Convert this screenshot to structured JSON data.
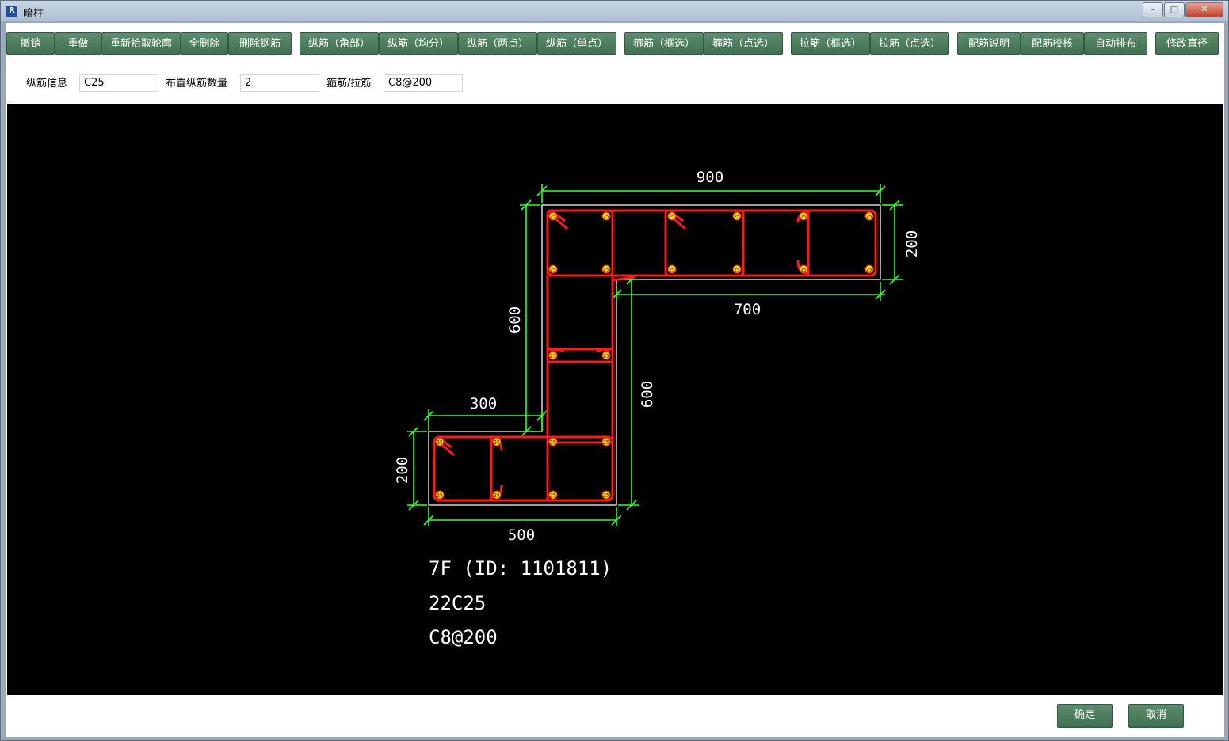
{
  "window": {
    "title": "暗柱"
  },
  "toolbar": {
    "buttons": [
      "撤销",
      "重做",
      "重新拾取轮廓",
      "全删除",
      "删除钢筋",
      "纵筋（角部）",
      "纵筋（均分）",
      "纵筋（两点）",
      "纵筋（单点）",
      "箍筋（框选）",
      "箍筋（点选）",
      "拉筋（框选）",
      "拉筋（点选）",
      "配筋说明",
      "配筋校核",
      "自动排布",
      "修改直径"
    ]
  },
  "fields": {
    "long_rebar_label": "纵筋信息",
    "long_rebar_value": "C25",
    "count_label": "布置纵筋数量",
    "count_value": "2",
    "stirrup_label": "箍筋/拉筋",
    "stirrup_value": "C8@200"
  },
  "drawing": {
    "dims": {
      "top": "900",
      "right": "200",
      "mid": "700",
      "left_upper": "600",
      "right_lower": "600",
      "left_short": "300",
      "left_lower": "200",
      "bottom": "500"
    },
    "rebar_label": "25",
    "notes": [
      "7F (ID: 1101811)",
      "22C25",
      "C8@200"
    ],
    "colors": {
      "rebar": "#ff1a1a",
      "dimension": "#33ff33",
      "outline": "#ffffff",
      "rebar_dot": "#ffd700"
    }
  },
  "footer": {
    "ok": "确定",
    "cancel": "取消"
  }
}
